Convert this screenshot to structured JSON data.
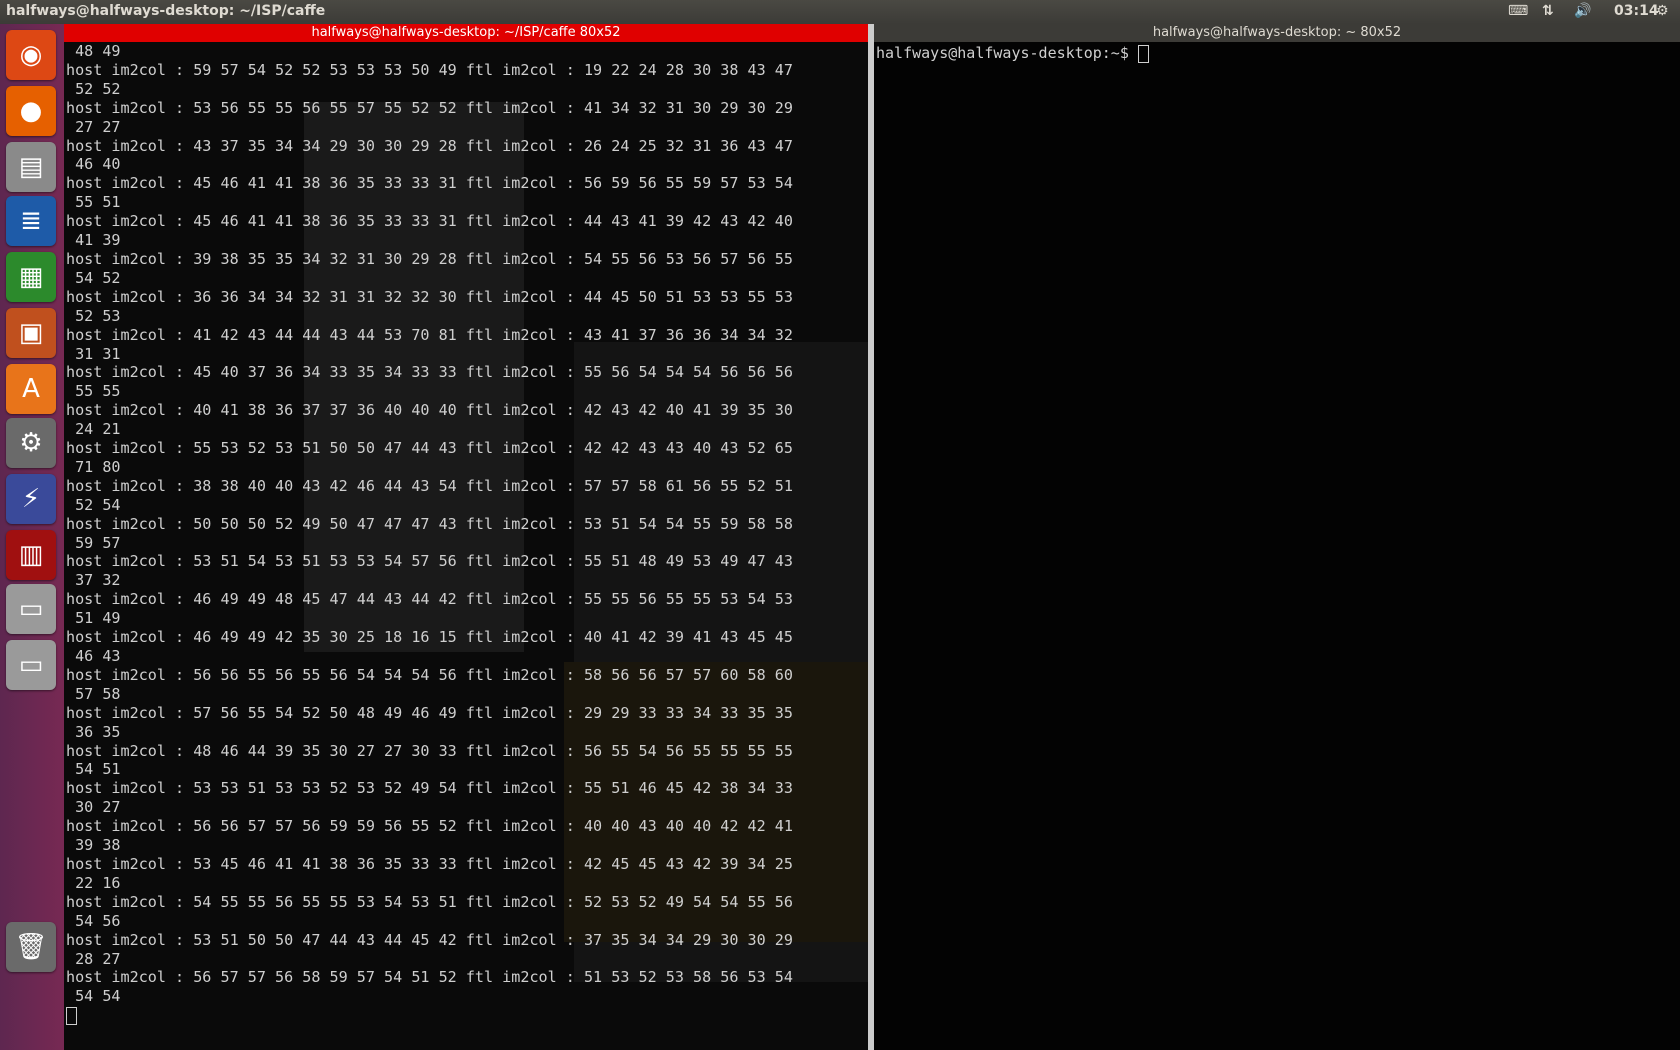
{
  "topbar": {
    "title": "halfways@halfways-desktop: ~/ISP/caffe",
    "time": "03:14"
  },
  "launcher": {
    "items": [
      {
        "name": "ubuntu-dash",
        "glyph": "◉",
        "color": "#dd4814"
      },
      {
        "name": "firefox",
        "glyph": "●",
        "color": "#e66000"
      },
      {
        "name": "files",
        "glyph": "▤",
        "color": "#8a8a8a"
      },
      {
        "name": "writer",
        "glyph": "≣",
        "color": "#1e5ba8"
      },
      {
        "name": "calc",
        "glyph": "▦",
        "color": "#2c8a2c"
      },
      {
        "name": "impress",
        "glyph": "▣",
        "color": "#c0501e"
      },
      {
        "name": "software-center",
        "glyph": "A",
        "color": "#e8741a"
      },
      {
        "name": "settings",
        "glyph": "⚙",
        "color": "#6a6a6a"
      },
      {
        "name": "network",
        "glyph": "⚡",
        "color": "#3a4a9a"
      },
      {
        "name": "terminal-app",
        "glyph": "▥",
        "color": "#a01010"
      },
      {
        "name": "disk1",
        "glyph": "▭",
        "color": "#9a9a9a"
      },
      {
        "name": "disk2",
        "glyph": "▭",
        "color": "#9a9a9a"
      },
      {
        "name": "trash",
        "glyph": "🗑",
        "color": "#6a6a6a"
      }
    ]
  },
  "term1": {
    "title": "halfways@halfways-desktop: ~/ISP/caffe 80x52",
    "lines": [
      " 48 49",
      "host im2col : 59 57 54 52 52 53 53 53 50 49 ftl im2col : 19 22 24 28 30 38 43 47",
      " 52 52",
      "host im2col : 53 56 55 55 56 55 57 55 52 52 ftl im2col : 41 34 32 31 30 29 30 29",
      " 27 27",
      "host im2col : 43 37 35 34 34 29 30 30 29 28 ftl im2col : 26 24 25 32 31 36 43 47",
      " 46 40",
      "host im2col : 45 46 41 41 38 36 35 33 33 31 ftl im2col : 56 59 56 55 59 57 53 54",
      " 55 51",
      "host im2col : 45 46 41 41 38 36 35 33 33 31 ftl im2col : 44 43 41 39 42 43 42 40",
      " 41 39",
      "host im2col : 39 38 35 35 34 32 31 30 29 28 ftl im2col : 54 55 56 53 56 57 56 55",
      " 54 52",
      "host im2col : 36 36 34 34 32 31 31 32 32 30 ftl im2col : 44 45 50 51 53 53 55 53",
      " 52 53",
      "host im2col : 41 42 43 44 44 43 44 53 70 81 ftl im2col : 43 41 37 36 36 34 34 32",
      " 31 31",
      "host im2col : 45 40 37 36 34 33 35 34 33 33 ftl im2col : 55 56 54 54 54 56 56 56",
      " 55 55",
      "host im2col : 40 41 38 36 37 37 36 40 40 40 ftl im2col : 42 43 42 40 41 39 35 30",
      " 24 21",
      "host im2col : 55 53 52 53 51 50 50 47 44 43 ftl im2col : 42 42 43 43 40 43 52 65",
      " 71 80",
      "host im2col : 38 38 40 40 43 42 46 44 43 54 ftl im2col : 57 57 58 61 56 55 52 51",
      " 52 54",
      "host im2col : 50 50 50 52 49 50 47 47 47 43 ftl im2col : 53 51 54 54 55 59 58 58",
      " 59 57",
      "host im2col : 53 51 54 53 51 53 53 54 57 56 ftl im2col : 55 51 48 49 53 49 47 43",
      " 37 32",
      "host im2col : 46 49 49 48 45 47 44 43 44 42 ftl im2col : 55 55 56 55 55 53 54 53",
      " 51 49",
      "host im2col : 46 49 49 42 35 30 25 18 16 15 ftl im2col : 40 41 42 39 41 43 45 45",
      " 46 43",
      "host im2col : 56 56 55 56 55 56 54 54 54 56 ftl im2col : 58 56 56 57 57 60 58 60",
      " 57 58",
      "host im2col : 57 56 55 54 52 50 48 49 46 49 ftl im2col : 29 29 33 33 34 33 35 35",
      " 36 35",
      "host im2col : 48 46 44 39 35 30 27 27 30 33 ftl im2col : 56 55 54 56 55 55 55 55",
      " 54 51",
      "host im2col : 53 53 51 53 53 52 53 52 49 54 ftl im2col : 55 51 46 45 42 38 34 33",
      " 30 27",
      "host im2col : 56 56 57 57 56 59 59 56 55 52 ftl im2col : 40 40 43 40 40 42 42 41",
      " 39 38",
      "host im2col : 53 45 46 41 41 38 36 35 33 33 ftl im2col : 42 45 45 43 42 39 34 25",
      " 22 16",
      "host im2col : 54 55 55 56 55 55 53 54 53 51 ftl im2col : 52 53 52 49 54 54 55 56",
      " 54 56",
      "host im2col : 53 51 50 50 47 44 43 44 45 42 ftl im2col : 37 35 34 34 29 30 30 29",
      " 28 27",
      "host im2col : 56 57 57 56 58 59 57 54 51 52 ftl im2col : 51 53 52 53 58 56 53 54",
      " 54 54"
    ]
  },
  "term2": {
    "title": "halfways@halfways-desktop: ~ 80x52",
    "prompt": "halfways@halfways-desktop:~$ "
  }
}
